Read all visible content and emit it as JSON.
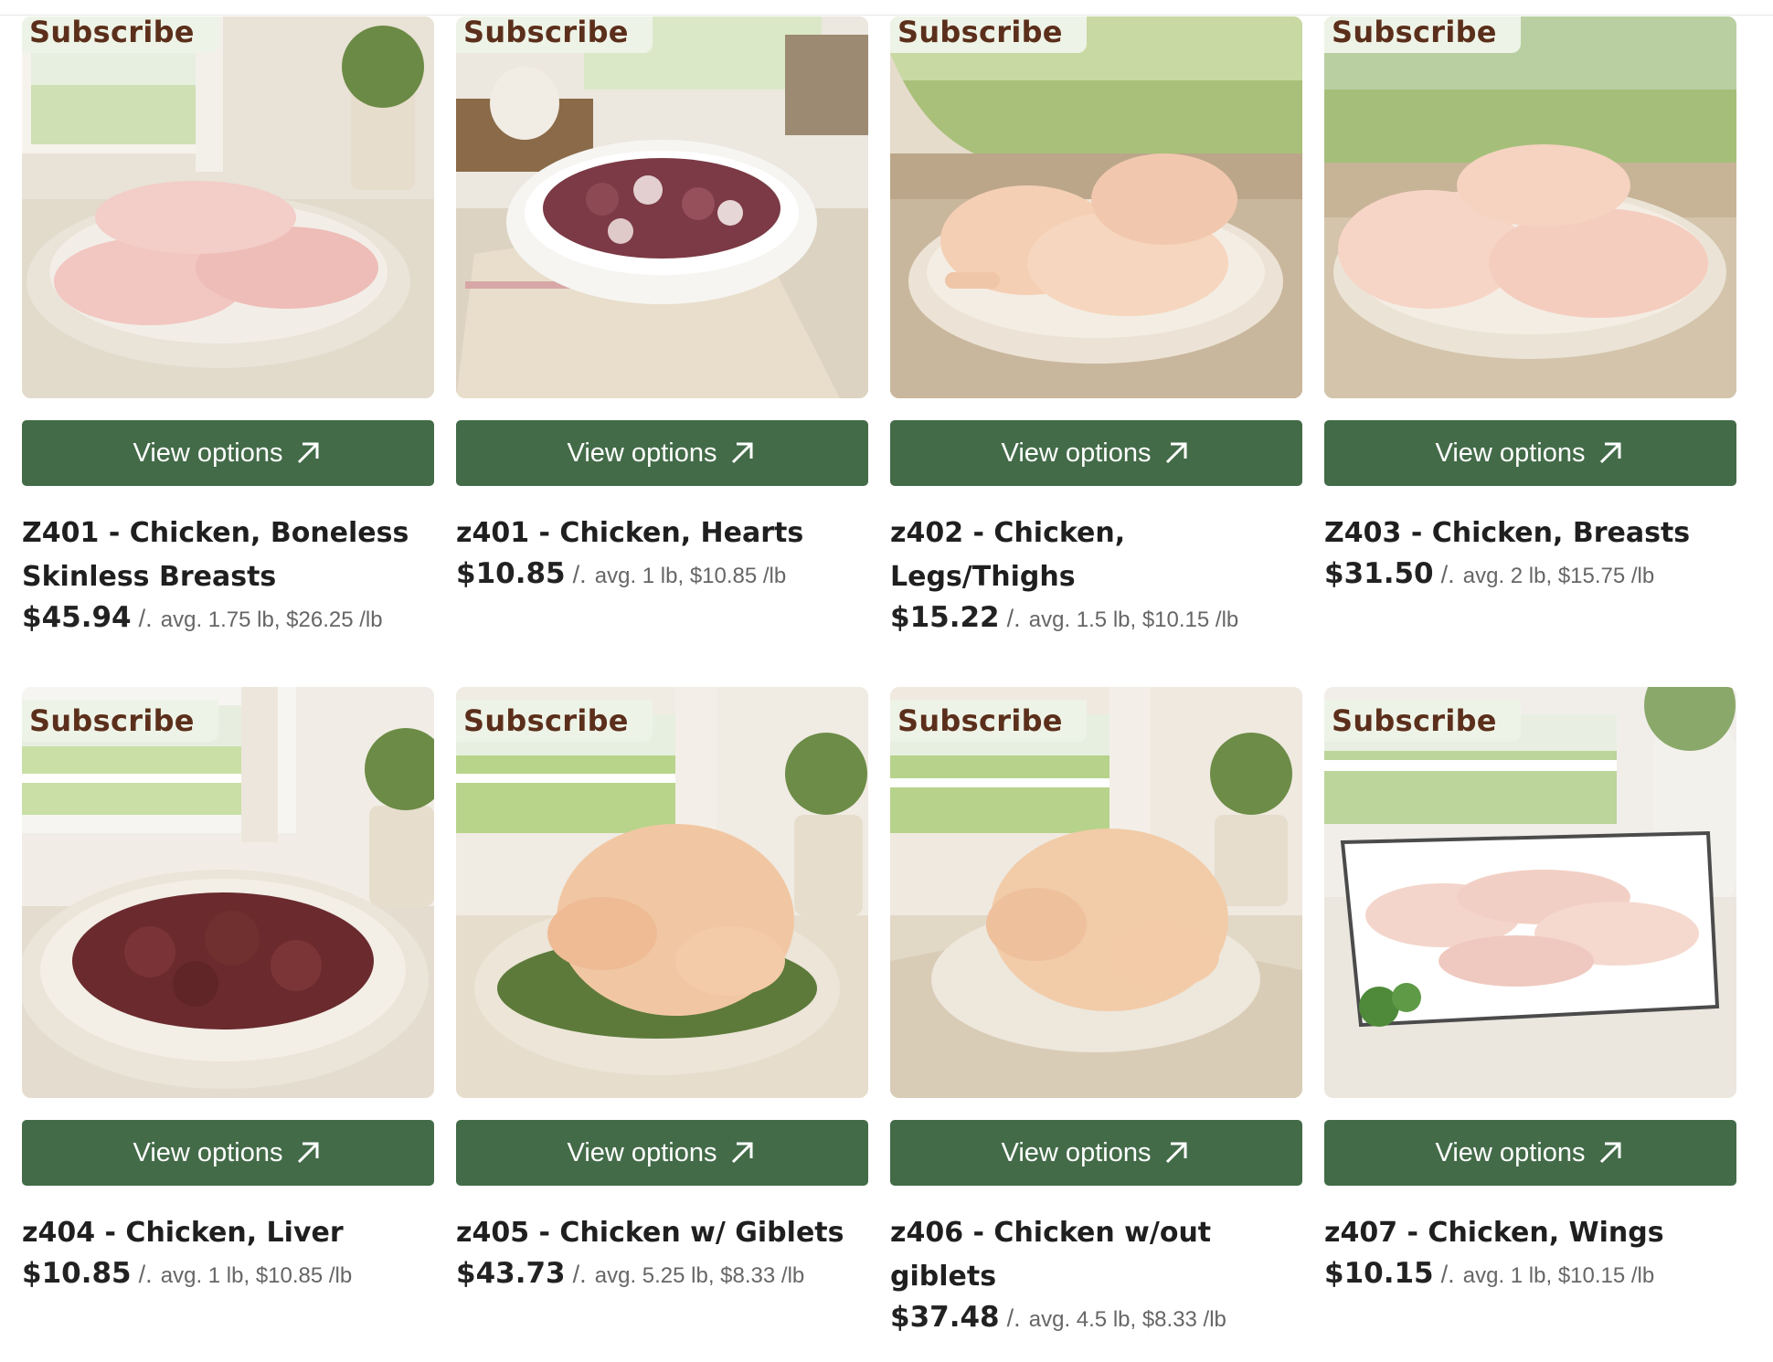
{
  "subscribe_label": "Subscribe",
  "button_label": "View options",
  "brand_color": "#436b48",
  "subscribe_color": "#5b2f1b",
  "products": [
    {
      "title": "Z401 - Chicken, Boneless Skinless Breasts",
      "price": "$45.94",
      "sep": "/.",
      "meta": "avg. 1.75 lb, $26.25 /lb",
      "image": "chicken-breasts-boneless"
    },
    {
      "title": "z401 - Chicken, Hearts",
      "price": "$10.85",
      "sep": "/.",
      "meta": "avg. 1 lb, $10.85 /lb",
      "image": "chicken-hearts"
    },
    {
      "title": "z402 - Chicken, Legs/Thighs",
      "price": "$15.22",
      "sep": "/.",
      "meta": "avg. 1.5 lb, $10.15 /lb",
      "image": "chicken-legs-thighs"
    },
    {
      "title": "Z403 - Chicken, Breasts",
      "price": "$31.50",
      "sep": "/.",
      "meta": "avg. 2 lb, $15.75 /lb",
      "image": "chicken-breasts"
    },
    {
      "title": "z404 - Chicken, Liver",
      "price": "$10.85",
      "sep": "/.",
      "meta": "avg. 1 lb, $10.85 /lb",
      "image": "chicken-liver"
    },
    {
      "title": "z405 - Chicken w/ Giblets",
      "price": "$43.73",
      "sep": "/.",
      "meta": "avg. 5.25 lb, $8.33 /lb",
      "image": "whole-chicken-giblets"
    },
    {
      "title": "z406 - Chicken w/out giblets",
      "price": "$37.48",
      "sep": "/.",
      "meta": "avg. 4.5 lb, $8.33 /lb",
      "image": "whole-chicken"
    },
    {
      "title": "z407 - Chicken, Wings",
      "price": "$10.15",
      "sep": "/.",
      "meta": "avg. 1 lb, $10.15 /lb",
      "image": "chicken-wings"
    }
  ]
}
